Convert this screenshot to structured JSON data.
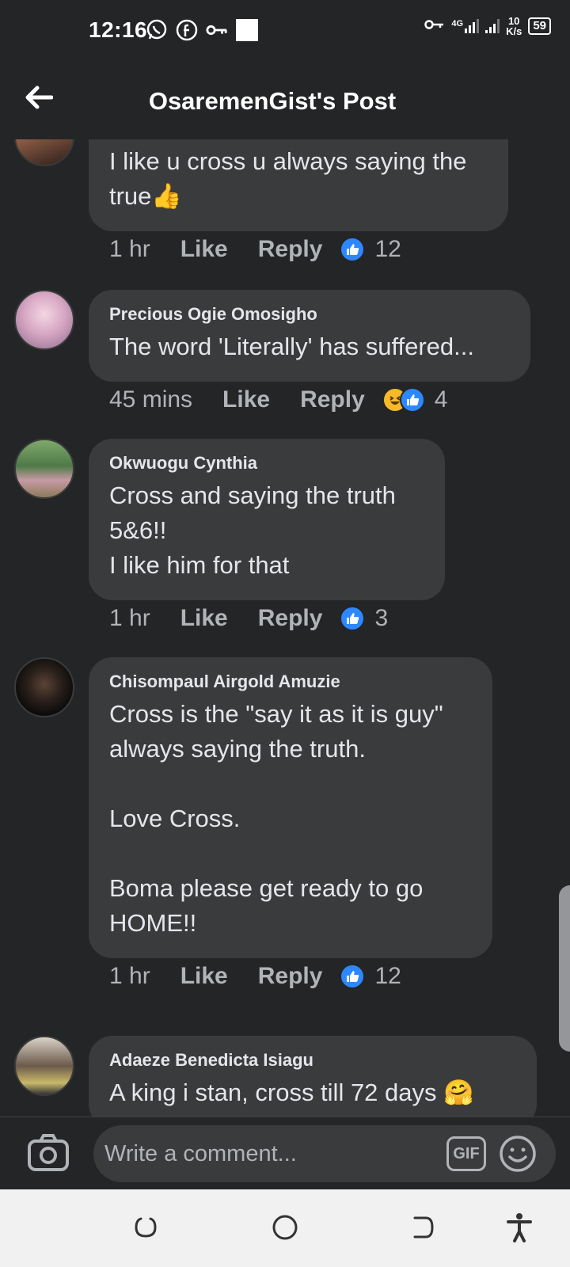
{
  "status_bar": {
    "time": "12:16",
    "network_type": "4G",
    "speed_value": "10",
    "speed_unit": "K/s",
    "battery": "59"
  },
  "header": {
    "title": "OsaremenGist's Post"
  },
  "comments": [
    {
      "author": "",
      "text": "I like u cross u always saying the true👍",
      "time": "1 hr",
      "like_label": "Like",
      "reply_label": "Reply",
      "reactions": [
        "like"
      ],
      "reaction_count": "12"
    },
    {
      "author": "Precious Ogie Omosigho",
      "text": "The word 'Literally' has suffered...",
      "time": "45 mins",
      "like_label": "Like",
      "reply_label": "Reply",
      "reactions": [
        "haha",
        "like"
      ],
      "reaction_count": "4"
    },
    {
      "author": "Okwuogu Cynthia",
      "text": "Cross and saying the truth\n5&6!!\nI like him for that",
      "time": "1 hr",
      "like_label": "Like",
      "reply_label": "Reply",
      "reactions": [
        "like"
      ],
      "reaction_count": "3"
    },
    {
      "author": "Chisompaul Airgold Amuzie",
      "text": "Cross is the \"say it as it is guy\"\nalways saying the truth.\n\nLove Cross.\n\nBoma please get ready to go\nHOME!!",
      "time": "1 hr",
      "like_label": "Like",
      "reply_label": "Reply",
      "reactions": [
        "like"
      ],
      "reaction_count": "12"
    },
    {
      "author": "Adaeze Benedicta Isiagu",
      "text": "A king i stan,  cross till 72 days 🤗",
      "time": "",
      "like_label": "",
      "reply_label": "",
      "reactions": [],
      "reaction_count": ""
    }
  ],
  "composer": {
    "placeholder": "Write a comment...",
    "gif_label": "GIF"
  },
  "icons": {
    "back": "arrow-left-icon",
    "camera": "camera-icon",
    "emoji": "smiley-icon",
    "like_reaction": "thumbs-up-icon",
    "haha_reaction": "laughing-face-icon",
    "nav_recents": "recents-icon",
    "nav_home": "home-circle-icon",
    "nav_back": "back-icon",
    "accessibility": "accessibility-icon"
  },
  "colors": {
    "background": "#242526",
    "bubble": "#3a3b3c",
    "like_blue": "#2d88ff",
    "haha_yellow": "#f7b928",
    "secondary_text": "#b0b3b8"
  }
}
